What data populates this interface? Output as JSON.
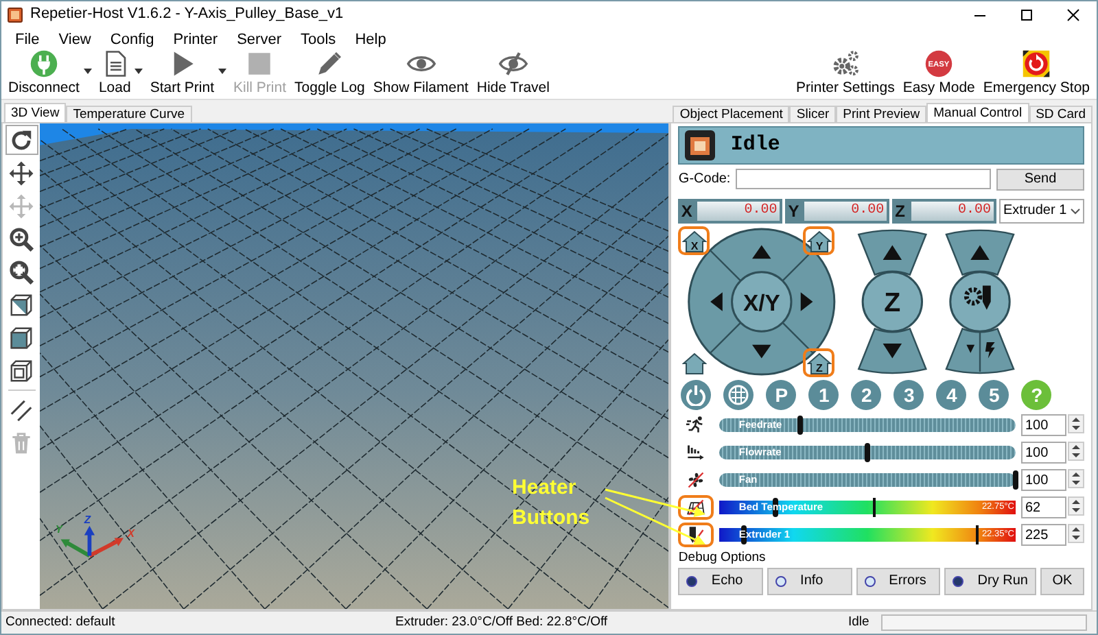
{
  "window": {
    "title": "Repetier-Host V1.6.2 - Y-Axis_Pulley_Base_v1"
  },
  "menu": [
    "File",
    "View",
    "Config",
    "Printer",
    "Server",
    "Tools",
    "Help"
  ],
  "toolbar": [
    {
      "kind": "disconnect",
      "label": "Disconnect",
      "disabled": false,
      "dropdown": true
    },
    {
      "kind": "load",
      "label": "Load",
      "disabled": false,
      "dropdown": true
    },
    {
      "kind": "start",
      "label": "Start Print",
      "disabled": false,
      "dropdown": true
    },
    {
      "kind": "kill",
      "label": "Kill Print",
      "disabled": true,
      "dropdown": false
    },
    {
      "kind": "log",
      "label": "Toggle Log",
      "disabled": false,
      "dropdown": false
    },
    {
      "kind": "filament",
      "label": "Show Filament",
      "disabled": false,
      "dropdown": false
    },
    {
      "kind": "travel",
      "label": "Hide Travel",
      "disabled": false,
      "dropdown": false
    }
  ],
  "toolbar_right": [
    {
      "kind": "settings",
      "label": "Printer Settings"
    },
    {
      "kind": "easy",
      "label": "Easy Mode",
      "badge": "EASY"
    },
    {
      "kind": "estop",
      "label": "Emergency Stop"
    }
  ],
  "left_tabs": [
    {
      "label": "3D View",
      "selected": true
    },
    {
      "label": "Temperature Curve",
      "selected": false
    }
  ],
  "view_tools": [
    {
      "kind": "rotate",
      "selected": true,
      "disabled": false
    },
    {
      "kind": "move",
      "selected": false,
      "disabled": false
    },
    {
      "kind": "move-object",
      "selected": false,
      "disabled": true
    },
    {
      "kind": "zoom",
      "selected": false,
      "disabled": false
    },
    {
      "kind": "fit",
      "selected": false,
      "disabled": false
    },
    {
      "kind": "view-iso",
      "selected": false,
      "disabled": false
    },
    {
      "kind": "view-front",
      "selected": false,
      "disabled": false
    },
    {
      "kind": "view-top",
      "selected": false,
      "disabled": false
    },
    {
      "kind": "parallel",
      "selected": false,
      "disabled": false
    },
    {
      "kind": "delete",
      "selected": false,
      "disabled": true
    }
  ],
  "view3d": {
    "axis_labels": {
      "x": "X",
      "y": "Y",
      "z": "Z"
    },
    "annotation": "Heater Buttons"
  },
  "right_tabs": [
    {
      "label": "Object Placement",
      "selected": false
    },
    {
      "label": "Slicer",
      "selected": false
    },
    {
      "label": "Print Preview",
      "selected": false
    },
    {
      "label": "Manual Control",
      "selected": true
    },
    {
      "label": "SD Card",
      "selected": false
    }
  ],
  "manual": {
    "status": "Idle",
    "gcode": {
      "label": "G-Code:",
      "button": "Send"
    },
    "coords": [
      {
        "axis": "X",
        "value": "0.00"
      },
      {
        "axis": "Y",
        "value": "0.00"
      },
      {
        "axis": "Z",
        "value": "0.00"
      }
    ],
    "extruder_select": "Extruder 1",
    "jog": {
      "xy": "X/Y",
      "z": "Z"
    },
    "home_buttons": [
      {
        "kind": "x",
        "label": "X",
        "highlighted": true
      },
      {
        "kind": "y",
        "label": "Y",
        "highlighted": true
      },
      {
        "kind": "z",
        "label": "Z",
        "highlighted": true
      },
      {
        "kind": "all",
        "highlighted": false
      }
    ],
    "quick_buttons": [
      {
        "kind": "power",
        "color": "#5b8c99"
      },
      {
        "kind": "fan",
        "color": "#5b8c99"
      },
      {
        "kind": "text",
        "label": "P",
        "color": "#5b8c99"
      },
      {
        "kind": "text",
        "label": "1",
        "color": "#5b8c99"
      },
      {
        "kind": "text",
        "label": "2",
        "color": "#5b8c99"
      },
      {
        "kind": "text",
        "label": "3",
        "color": "#5b8c99"
      },
      {
        "kind": "text",
        "label": "4",
        "color": "#5b8c99"
      },
      {
        "kind": "text",
        "label": "5",
        "color": "#5b8c99"
      },
      {
        "kind": "text",
        "label": "?",
        "color": "#6cbf3a"
      }
    ],
    "sliders": [
      {
        "kind": "feedrate",
        "label": "Feedrate",
        "level": 0.27,
        "value": "100",
        "highlighted": false
      },
      {
        "kind": "flowrate",
        "label": "Flowrate",
        "level": 0.5,
        "value": "100",
        "highlighted": false
      },
      {
        "kind": "fan",
        "label": "Fan",
        "level": 1.0,
        "value": "100",
        "highlighted": false
      },
      {
        "kind": "bed",
        "label": "Bed Temperature",
        "reading": "22.75°C",
        "current": {
          "level": 0.19
        },
        "target": {
          "level": 0.52
        },
        "value": "62",
        "highlighted": true
      },
      {
        "kind": "extruder",
        "label": "Extruder 1",
        "reading": "22.35°C",
        "current": {
          "level": 0.08
        },
        "target": {
          "level": 0.87
        },
        "value": "225",
        "highlighted": true
      }
    ],
    "debug": {
      "title": "Debug Options",
      "options": [
        {
          "label": "Echo",
          "on": true
        },
        {
          "label": "Info",
          "on": false
        },
        {
          "label": "Errors",
          "on": false
        },
        {
          "label": "Dry Run",
          "on": true
        }
      ],
      "button": "OK"
    }
  },
  "status_bar": {
    "connection": "Connected: default",
    "temperatures": "Extruder: 23.0°C/Off Bed: 22.8°C/Off",
    "state": "Idle",
    "progress": {
      "level": 0
    }
  }
}
